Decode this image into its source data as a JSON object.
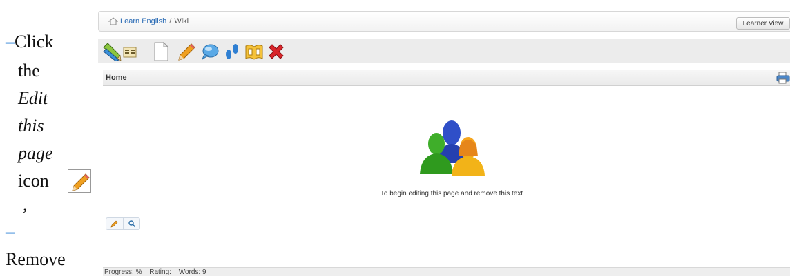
{
  "doc": {
    "bullet1": {
      "dash": "–",
      "word1": "Click",
      "word2": "the",
      "word3": "Edit",
      "word4": "this",
      "word5": "page",
      "word6": "icon",
      "trailing": ","
    },
    "bullet2": {
      "dash": "–",
      "word1": "Remove"
    }
  },
  "breadcrumb": {
    "home_link": "Learn English",
    "separator": "/",
    "current": "Wiki"
  },
  "learner_view_label": "Learner View",
  "toolbar": {
    "icons": [
      "pencils-icon",
      "list-icon",
      "new-page-icon",
      "edit-pencil-icon",
      "comment-bubble-icon",
      "footprints-icon",
      "book-icon",
      "delete-icon"
    ]
  },
  "page": {
    "title": "Home",
    "begin_text": "To begin editing this page and remove this text"
  },
  "status": {
    "progress": "Progress: %",
    "rating": "Rating:",
    "words": "Words: 9"
  },
  "colors": {
    "link": "#2a6bb5",
    "accent_dash": "#2a7fd4",
    "delete": "#d9252a"
  }
}
